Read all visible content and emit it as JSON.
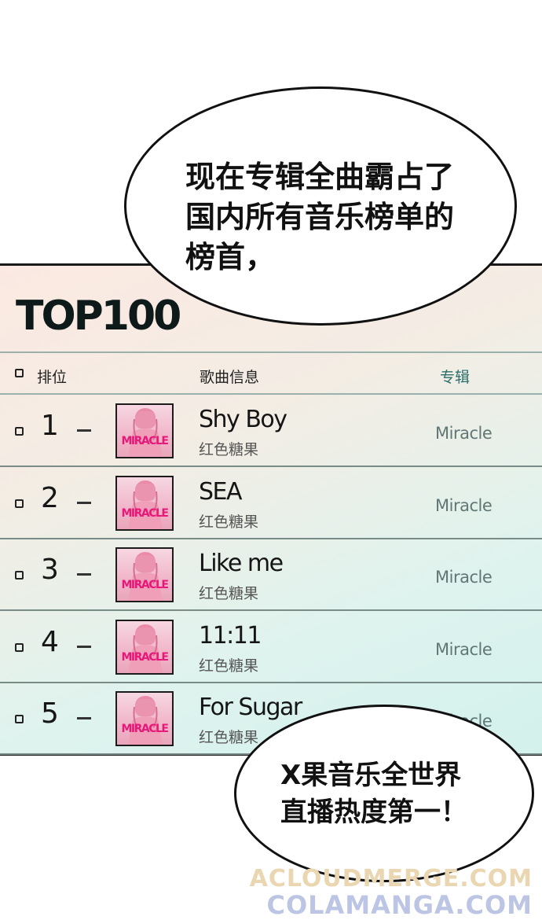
{
  "bubble_top": {
    "text": "现在专辑全曲霸占了\n国内所有音乐榜单的\n榜首，"
  },
  "chart": {
    "title": "TOP100",
    "headers": {
      "rank": "排位",
      "song_info": "歌曲信息",
      "album": "专辑"
    },
    "rows": [
      {
        "rank": "1",
        "song": "Shy Boy",
        "artist": "红色糖果",
        "album": "Miracle",
        "cover_label": "MIRACLE"
      },
      {
        "rank": "2",
        "song": "SEA",
        "artist": "红色糖果",
        "album": "Miracle",
        "cover_label": "MIRACLE"
      },
      {
        "rank": "3",
        "song": "Like me",
        "artist": "红色糖果",
        "album": "Miracle",
        "cover_label": "MIRACLE"
      },
      {
        "rank": "4",
        "song": "11:11",
        "artist": "红色糖果",
        "album": "Miracle",
        "cover_label": "MIRACLE"
      },
      {
        "rank": "5",
        "song": "For Sugar",
        "artist": "红色糖果",
        "album": "Miracle",
        "cover_label": "MIRACLE"
      }
    ]
  },
  "bubble_bottom": {
    "text": "X果音乐全世界\n直播热度第一！"
  },
  "watermarks": [
    "ACLOUDMERGE.COM",
    "COLAMANGA.COM"
  ]
}
